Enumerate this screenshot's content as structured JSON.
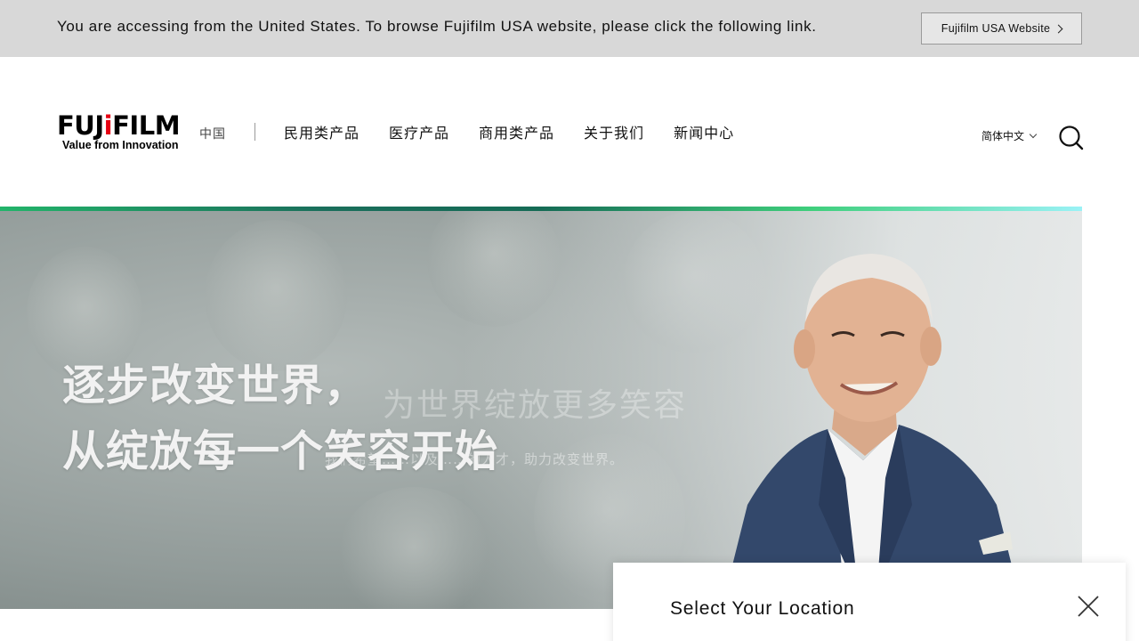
{
  "notice": {
    "text": "You are accessing from the United States. To browse Fujifilm USA website, please click the following link.",
    "button_label": "Fujifilm USA Website",
    "button_icon": "chevron-right-icon"
  },
  "header": {
    "logo": {
      "wordmark_prefix": "FUJ",
      "wordmark_i": "i",
      "wordmark_suffix": "FILM",
      "tagline": "Value from Innovation"
    },
    "region": "中国",
    "nav": [
      {
        "label": "民用类产品"
      },
      {
        "label": "医疗产品"
      },
      {
        "label": "商用类产品"
      },
      {
        "label": "关于我们"
      },
      {
        "label": "新闻中心"
      }
    ],
    "language": "简体中文",
    "search_icon": "search-icon"
  },
  "hero": {
    "headline_line1": "逐步改变世界，",
    "headline_line2": "从绽放每一个笑容开始",
    "ghost_headline": "为世界绽放更多笑容",
    "ghost_subtext": "我们希望……以及……的人才，助力改变世界。"
  },
  "popup": {
    "title": "Select Your Location",
    "close_icon": "close-icon"
  },
  "colors": {
    "notice_bg": "#d8d8d8",
    "brand_red": "#e60012",
    "accent_green": "#22b46a",
    "accent_cyan": "#9af2f6"
  }
}
